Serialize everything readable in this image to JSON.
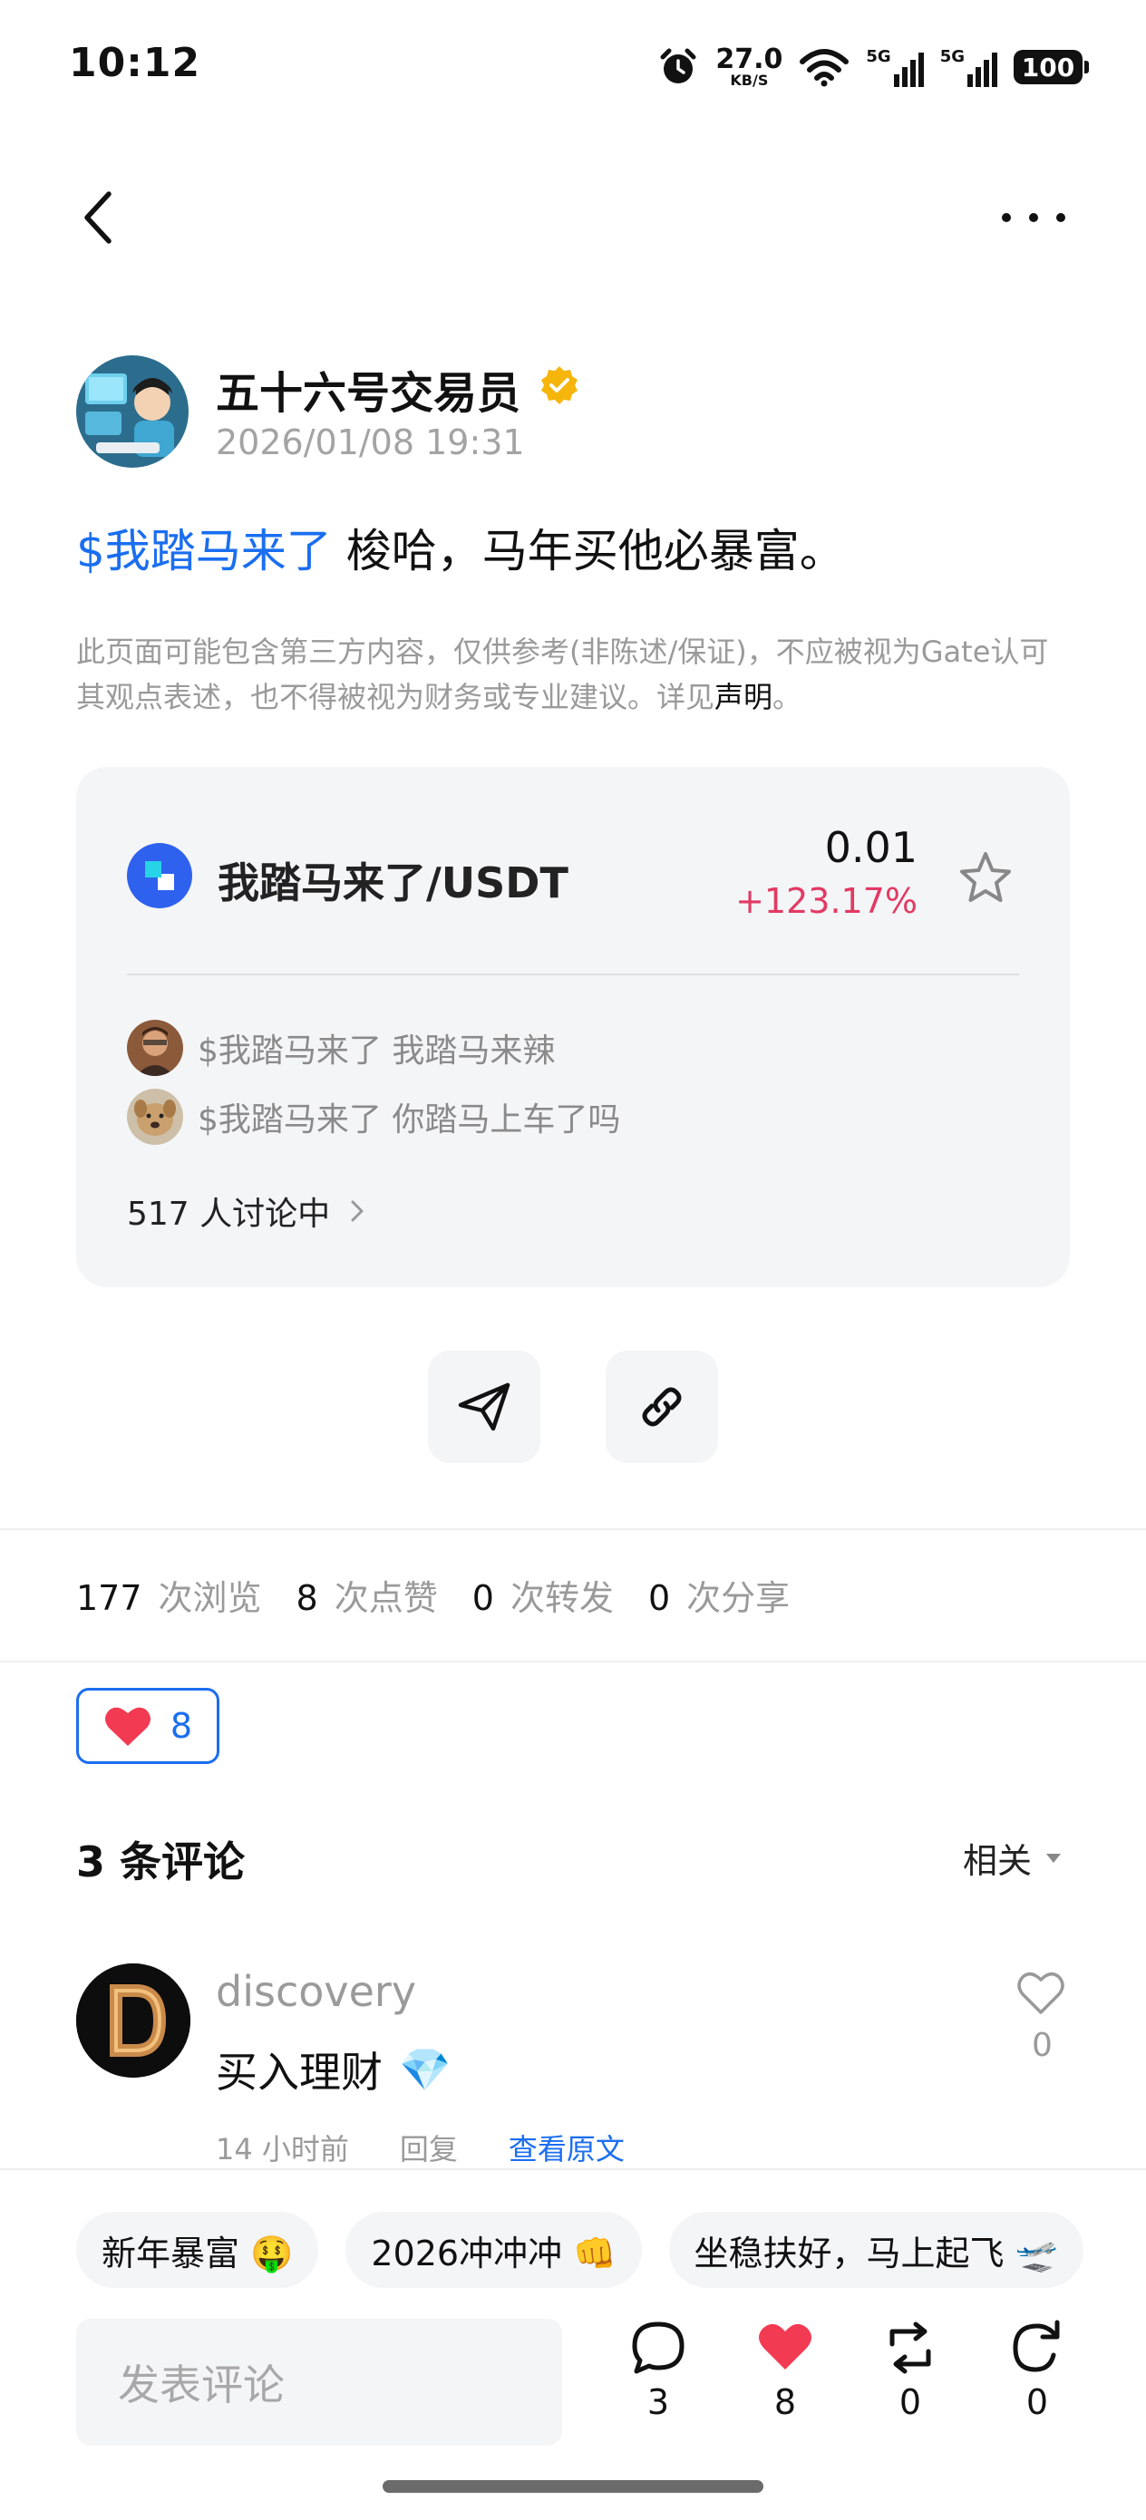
{
  "status_bar": {
    "time": "10:12",
    "speed_value": "27.0",
    "speed_unit": "KB/S",
    "signal1": "5G",
    "signal2": "5G",
    "battery": "100"
  },
  "nav": {
    "back_icon": "chevron-left-icon",
    "more_icon": "more-dots-icon"
  },
  "post": {
    "author": "五十六号交易员",
    "timestamp": "2026/01/08 19:31",
    "hashtag": "$我踏马来了",
    "text": " 梭哈，马年买他必暴富。",
    "disclaimer": "此页面可能包含第三方内容，仅供参考(非陈述/保证)，不应被视为Gate认可其观点表述，也不得被视为财务或专业建议。详见",
    "disclaimer_link": "声明",
    "disclaimer_end": "。"
  },
  "coin_card": {
    "pair": "我踏马来了/USDT",
    "price": "0.01",
    "change": "+123.17%",
    "discussions": [
      {
        "tag": "$我踏马来了",
        "text": "我踏马来辣"
      },
      {
        "tag": "$我踏马来了",
        "text": "你踏马上车了吗"
      }
    ],
    "discussing": "517 人讨论中"
  },
  "stats": {
    "views": "177",
    "views_label": "次浏览",
    "likes": "8",
    "likes_label": "次点赞",
    "reposts": "0",
    "reposts_label": "次转发",
    "shares": "0",
    "shares_label": "次分享"
  },
  "reaction": {
    "count": "8"
  },
  "comments": {
    "title": "3 条评论",
    "sort": "相关",
    "items": [
      {
        "user": "discovery",
        "text": "买入理财",
        "emoji": "💎",
        "time": "14 小时前",
        "reply": "回复",
        "view_original": "查看原文",
        "likes": "0"
      }
    ]
  },
  "bottom": {
    "chips": [
      "新年暴富 🤑",
      "2026冲冲冲 👊",
      "坐稳扶好，马上起飞 🛫"
    ],
    "input_placeholder": "发表评论",
    "comments_count": "3",
    "likes_count": "8",
    "reposts_count": "0",
    "shares_count": "0"
  },
  "colors": {
    "accent": "#1a6ef0",
    "positive_change": "#e23a63",
    "like_red": "#f23a52",
    "verified_gold": "#f5b50a"
  }
}
